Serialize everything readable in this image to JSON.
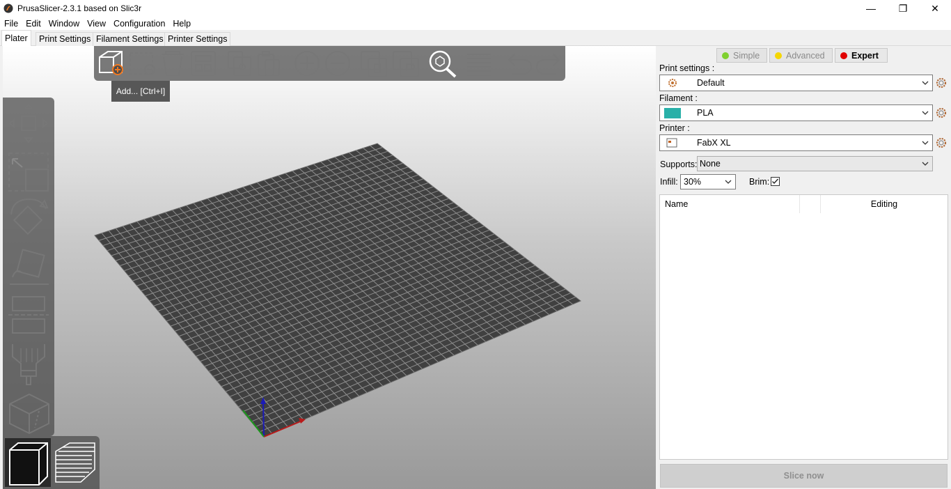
{
  "window": {
    "title": "PrusaSlicer-2.3.1 based on Slic3r",
    "minimize": "—",
    "maximize": "❐",
    "close": "✕"
  },
  "menu": [
    "File",
    "Edit",
    "Window",
    "View",
    "Configuration",
    "Help"
  ],
  "tabs": [
    "Plater",
    "Print Settings",
    "Filament Settings",
    "Printer Settings"
  ],
  "toolbar": {
    "tooltip": "Add... [Ctrl+I]",
    "buttons": [
      "add-icon",
      "delete-icon",
      "delete-all-icon",
      "arrange-icon",
      "copy-icon",
      "paste-icon",
      "add-instance-icon",
      "remove-instance-icon",
      "split-objects-icon",
      "split-parts-icon",
      "search-icon",
      "layers-editing-icon",
      "undo-icon",
      "redo-icon"
    ]
  },
  "left_tools": [
    "move-icon",
    "scale-icon",
    "rotate-icon",
    "place-on-face-icon",
    "cut-icon",
    "paint-supports-icon",
    "seam-icon"
  ],
  "views": [
    "3d-view-icon",
    "preview-icon"
  ],
  "panel": {
    "modes": {
      "simple": "Simple",
      "advanced": "Advanced",
      "expert": "Expert"
    },
    "mode_colors": {
      "simple": "#7fd02f",
      "advanced": "#f5d600",
      "expert": "#e00000"
    },
    "print_settings_label": "Print settings :",
    "print_settings_value": "Default",
    "filament_label": "Filament :",
    "filament_value": "PLA",
    "filament_color": "#29b0a8",
    "printer_label": "Printer :",
    "printer_value": "FabX XL",
    "supports_label": "Supports:",
    "supports_value": "None",
    "infill_label": "Infill:",
    "infill_value": "30%",
    "brim_label": "Brim:",
    "brim_checked": true,
    "list_columns": [
      "Name",
      "",
      "Editing"
    ],
    "slice_button": "Slice now"
  }
}
